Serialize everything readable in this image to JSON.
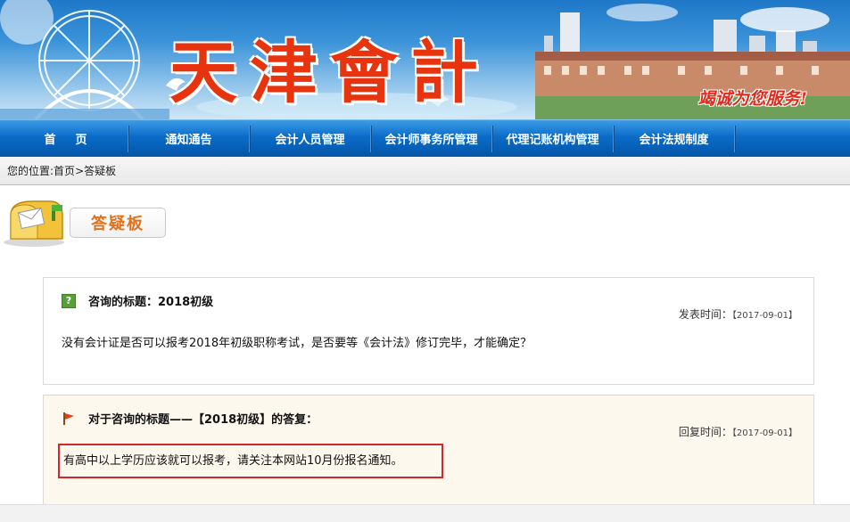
{
  "banner": {
    "logo_text": "天津會計",
    "slogan": "竭诚为您服务!"
  },
  "nav": {
    "items": [
      {
        "label": "首页"
      },
      {
        "label": "通知通告"
      },
      {
        "label": "会计人员管理"
      },
      {
        "label": "会计师事务所管理"
      },
      {
        "label": "代理记账机构管理"
      },
      {
        "label": "会计法规制度"
      }
    ]
  },
  "breadcrumb": {
    "prefix": "您的位置:",
    "home": "首页",
    "separator": ">",
    "current": "答疑板"
  },
  "section": {
    "title": "答疑板"
  },
  "question": {
    "icon": "question-icon",
    "title": "咨询的标题：2018初级",
    "time_label": "发表时间：",
    "time_value": "【2017-09-01】",
    "body": "没有会计证是否可以报考2018年初级职称考试，是否要等《会计法》修订完毕，才能确定？"
  },
  "answer": {
    "icon": "flag-icon",
    "title": "对于咨询的标题——【2018初级】的答复：",
    "time_label": "回复时间：",
    "time_value": "【2017-09-01】",
    "body": "有高中以上学历应该就可以报考，请关注本网站10月份报名通知。",
    "highlight_color": "#d3272b"
  },
  "colors": {
    "nav_blue": "#0a6cc8",
    "logo_red": "#e8340e",
    "tag_orange": "#e0721e"
  }
}
